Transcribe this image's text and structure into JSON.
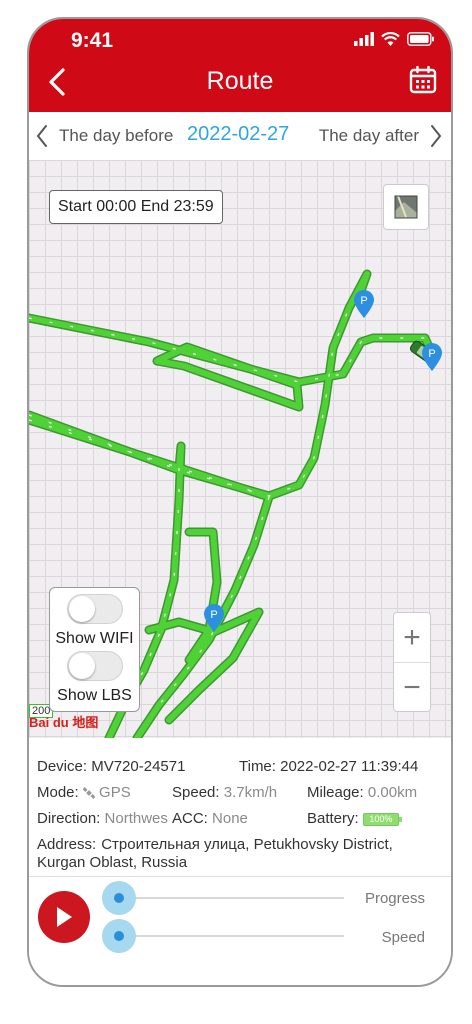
{
  "status": {
    "time": "9:41"
  },
  "header": {
    "title": "Route",
    "back_icon": "chevron-left-icon",
    "calendar_icon": "calendar-icon",
    "color": "#cf0a16"
  },
  "daybar": {
    "prev_label": "The day before",
    "date": "2022-02-27",
    "next_label": "The day after",
    "date_color": "#2ea6e0"
  },
  "map": {
    "time_range": "Start 00:00 End 23:59",
    "toggles": [
      {
        "label": "Show WIFI",
        "on": false
      },
      {
        "label": "Show LBS",
        "on": false
      }
    ],
    "zoom_in": "+",
    "zoom_out": "−",
    "parking_marker": "P",
    "label_partial": "200",
    "brand": "Bai du 地图",
    "route_color": "#3ec02b"
  },
  "info": {
    "device_label": "Device:",
    "device_value": "MV720-24571",
    "time_label": "Time:",
    "time_value": "2022-02-27 11:39:44",
    "mode_label": "Mode:",
    "mode_value": "GPS",
    "speed_label": "Speed:",
    "speed_value": "3.7km/h",
    "mileage_label": "Mileage:",
    "mileage_value": "0.00km",
    "direction_label": "Direction:",
    "direction_value": "Northwes",
    "acc_label": "ACC:",
    "acc_value": "None",
    "battery_label": "Battery:",
    "battery_value": "100%",
    "address_label": "Address:",
    "address_value": "Строительная улица, Petukhovsky District, Kurgan Oblast, Russia"
  },
  "playback": {
    "progress_label": "Progress",
    "speed_label": "Speed",
    "progress": 0,
    "speed": 0
  }
}
